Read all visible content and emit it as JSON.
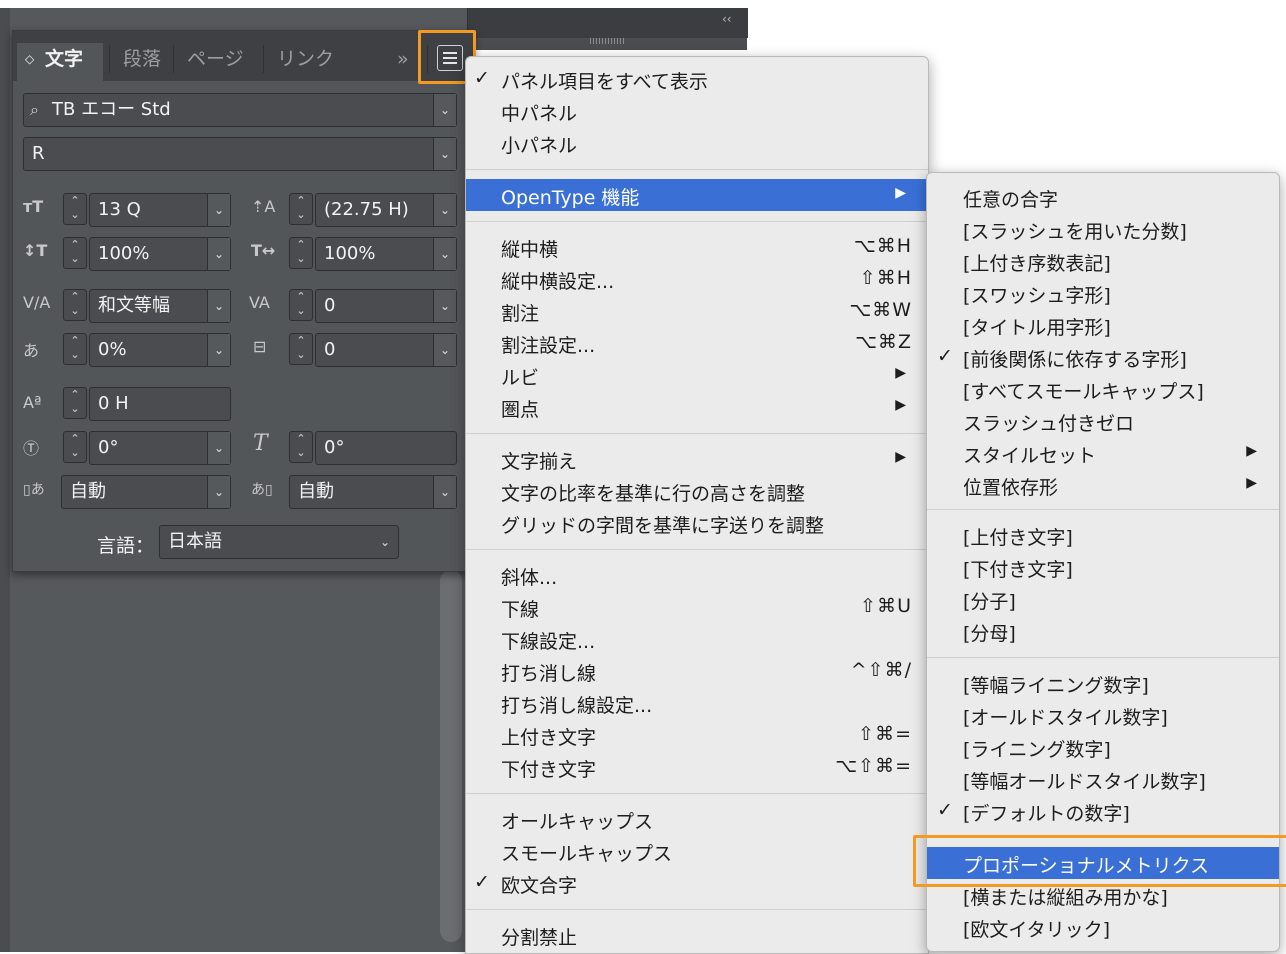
{
  "panel": {
    "tabs": [
      {
        "label": "文字",
        "icon": "diamond-collapse-icon"
      },
      {
        "label": "段落"
      },
      {
        "label": "ページ"
      },
      {
        "label": "リンク"
      }
    ],
    "overflow_label": "»",
    "font_family": "TB エコー Std",
    "font_style": "R",
    "font_size": "13 Q",
    "leading": "(22.75 H)",
    "vertical_scale": "100%",
    "horizontal_scale": "100%",
    "kerning": "和文等幅",
    "tracking": "0",
    "tsume": "0%",
    "aki": "0",
    "baseline_shift": "0 H",
    "char_rotation": "0°",
    "skew": "0°",
    "aki_before": "自動",
    "aki_after": "自動",
    "language_label": "言語：",
    "language": "日本語",
    "collapse_label": "‹‹"
  },
  "main_menu": {
    "items": [
      {
        "label": "パネル項目をすべて表示",
        "checked": true
      },
      {
        "label": "中パネル"
      },
      {
        "label": "小パネル"
      },
      {
        "label": "OpenType 機能",
        "submenu": true,
        "highlighted": true
      },
      {
        "label": "縦中横",
        "shortcut": "⌥⌘H"
      },
      {
        "label": "縦中横設定...",
        "shortcut": "⇧⌘H"
      },
      {
        "label": "割注",
        "shortcut": "⌥⌘W"
      },
      {
        "label": "割注設定...",
        "shortcut": "⌥⌘Z"
      },
      {
        "label": "ルビ",
        "submenu": true
      },
      {
        "label": "圏点",
        "submenu": true
      },
      {
        "label": "文字揃え",
        "submenu": true
      },
      {
        "label": "文字の比率を基準に行の高さを調整"
      },
      {
        "label": "グリッドの字間を基準に字送りを調整"
      },
      {
        "label": "斜体..."
      },
      {
        "label": "下線",
        "shortcut": "⇧⌘U"
      },
      {
        "label": "下線設定..."
      },
      {
        "label": "打ち消し線",
        "shortcut": "^⇧⌘/"
      },
      {
        "label": "打ち消し線設定..."
      },
      {
        "label": "上付き文字",
        "shortcut": "⇧⌘="
      },
      {
        "label": "下付き文字",
        "shortcut": "⌥⇧⌘="
      },
      {
        "label": "オールキャップス"
      },
      {
        "label": "スモールキャップス"
      },
      {
        "label": "欧文合字",
        "checked": true
      },
      {
        "label": "分割禁止"
      }
    ]
  },
  "submenu": {
    "items": [
      {
        "label": "任意の合字"
      },
      {
        "label": "[スラッシュを用いた分数]"
      },
      {
        "label": "[上付き序数表記]"
      },
      {
        "label": "[スワッシュ字形]"
      },
      {
        "label": "[タイトル用字形]"
      },
      {
        "label": "[前後関係に依存する字形]",
        "checked": true
      },
      {
        "label": "[すべてスモールキャップス]"
      },
      {
        "label": "スラッシュ付きゼロ"
      },
      {
        "label": "スタイルセット",
        "submenu": true
      },
      {
        "label": "位置依存形",
        "submenu": true
      },
      {
        "label": "[上付き文字]"
      },
      {
        "label": "[下付き文字]"
      },
      {
        "label": "[分子]"
      },
      {
        "label": "[分母]"
      },
      {
        "label": "[等幅ライニング数字]"
      },
      {
        "label": "[オールドスタイル数字]"
      },
      {
        "label": "[ライニング数字]"
      },
      {
        "label": "[等幅オールドスタイル数字]"
      },
      {
        "label": "[デフォルトの数字]",
        "checked": true
      },
      {
        "label": "プロポーショナルメトリクス",
        "highlighted": true
      },
      {
        "label": "[横または縦組み用かな]"
      },
      {
        "label": "[欧文イタリック]"
      }
    ]
  },
  "glyphs": {
    "check": "✓",
    "submenu_arrow": "▶",
    "dropdown_arrow": "⌄",
    "stepper": "⌃⌄"
  },
  "colors": {
    "accent_highlight": "#f29a22",
    "menu_selection": "#3a70d6",
    "panel_bg": "#535659"
  }
}
